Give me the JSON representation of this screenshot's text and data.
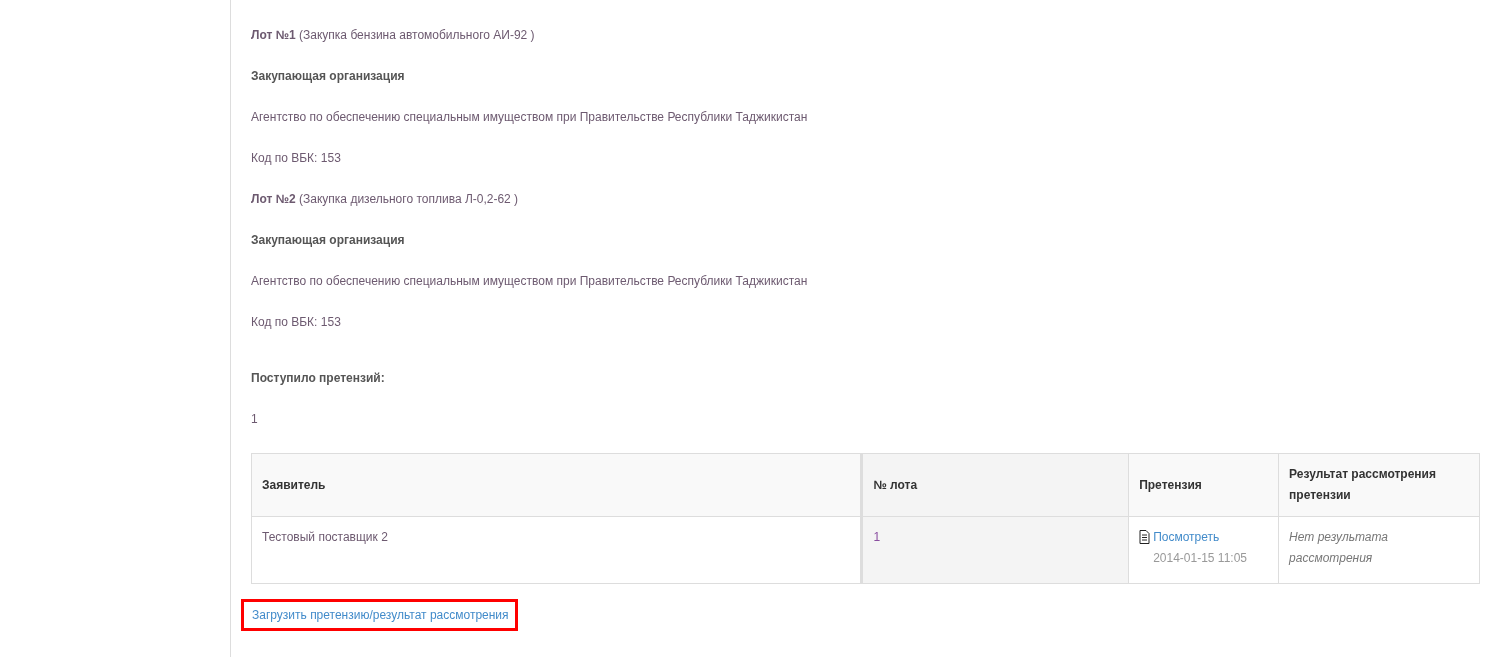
{
  "lots": [
    {
      "title": "**Лот №1** (Закупка бензина автомобильного АИ-92 )",
      "org_heading": "Закупающая организация",
      "org_name": "Агентство по обеспечению специальным имуществом при Правительстве Республики Таджикистан",
      "code": "Код по ВБК: 153"
    },
    {
      "title": "**Лот №2** (Закупка дизельного топлива Л-0,2-62 )",
      "org_heading": "Закупающая организация",
      "org_name": "Агентство по обеспечению специальным имуществом при Правительстве Республики Таджикистан",
      "code": "Код по ВБК: 153"
    }
  ],
  "claims": {
    "heading": "Поступило претензий:",
    "count": "1"
  },
  "table": {
    "columns": [
      {
        "label": "Заявитель",
        "sorted": false
      },
      {
        "label": "№ лота",
        "sorted": true
      },
      {
        "label": "Претензия",
        "sorted": false
      },
      {
        "label": "Результат рассмотрения претензии",
        "sorted": false
      }
    ],
    "rows": [
      {
        "applicant": "Тестовый поставщик 2",
        "lot": "1",
        "claim_link": "Посмотреть",
        "claim_date": "2014-01-15 11:05",
        "result": "Нет результата рассмотрения"
      }
    ]
  },
  "upload_link": {
    "label": "Загрузить претензию/результат рассмотрения",
    "highlighted": true
  }
}
